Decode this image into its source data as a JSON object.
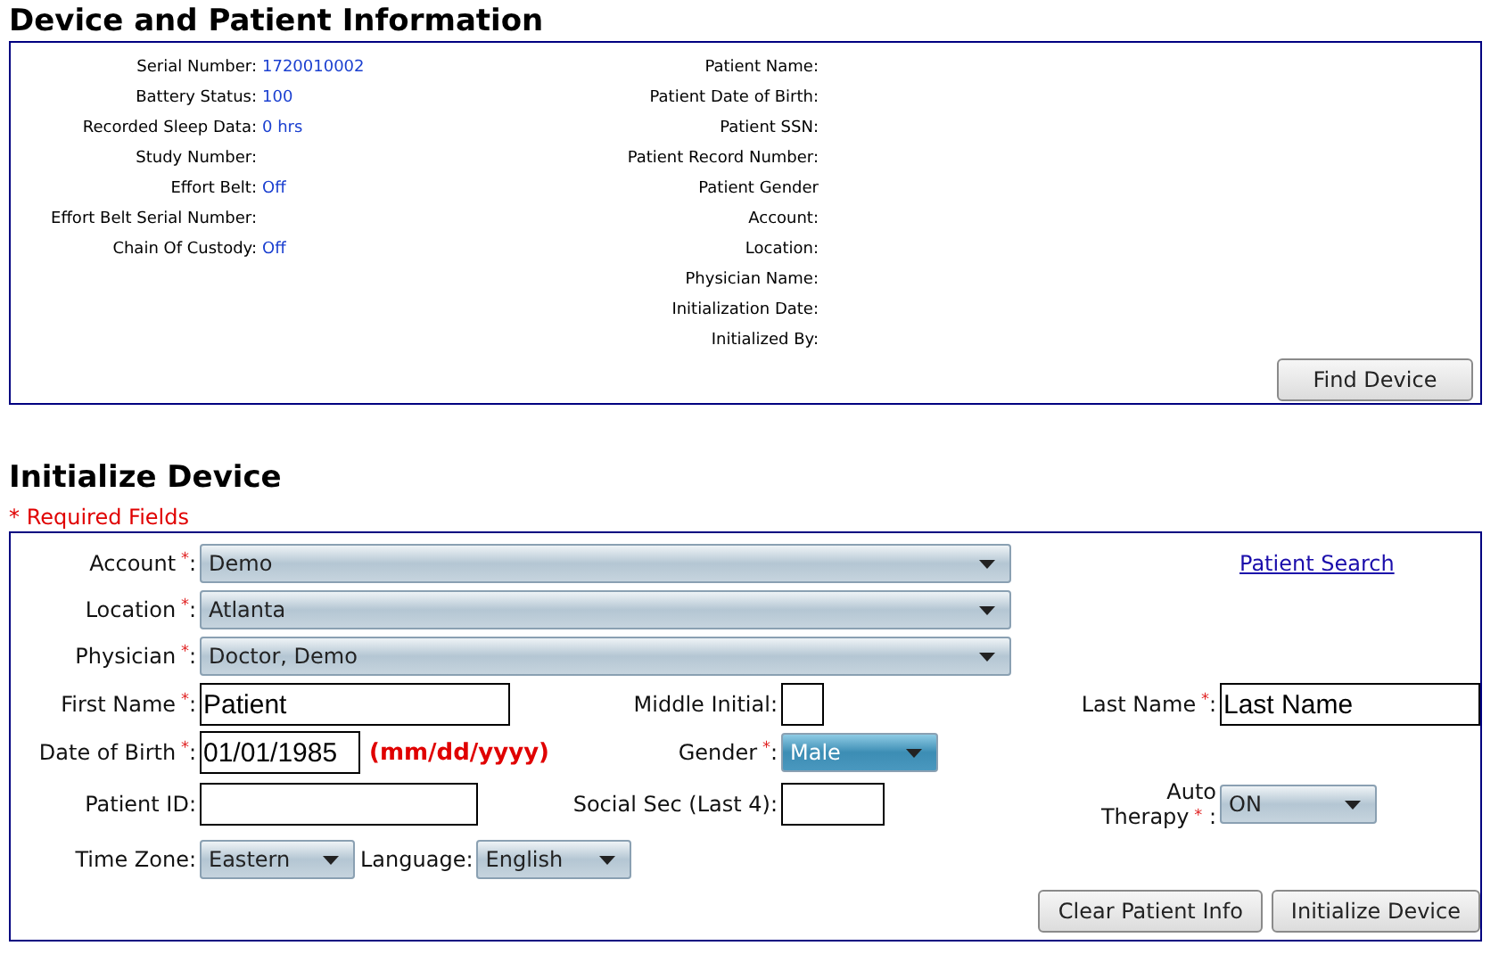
{
  "device_info": {
    "title": "Device and Patient Information",
    "device_fields": [
      {
        "label": "Serial Number:",
        "value": "1720010002"
      },
      {
        "label": "Battery Status:",
        "value": "100"
      },
      {
        "label": "Recorded Sleep Data:",
        "value": "0 hrs"
      },
      {
        "label": "Study Number:"
      },
      {
        "label": "Effort Belt:",
        "value": "Off"
      },
      {
        "label": "Effort Belt Serial Number:"
      },
      {
        "label": "Chain Of Custody:",
        "value": "Off"
      }
    ],
    "patient_fields": [
      {
        "label": "Patient Name:"
      },
      {
        "label": "Patient Date of Birth:"
      },
      {
        "label": "Patient SSN:"
      },
      {
        "label": "Patient Record Number:"
      },
      {
        "label": "Patient Gender"
      },
      {
        "label": "Account:"
      },
      {
        "label": "Location:"
      },
      {
        "label": "Physician Name:"
      },
      {
        "label": "Initialization Date:"
      },
      {
        "label": "Initialized By:"
      }
    ],
    "button": "Find Device"
  },
  "initialize_device": {
    "title": "Initialize Device",
    "required_note": "* Required Fields",
    "rows": [
      [
        {
          "kind": "select",
          "label": "Account",
          "required_mark": "*",
          "label_end": ":",
          "value": "Demo",
          "highlighted": false
        },
        {
          "kind": "link",
          "text": "Patient Search"
        }
      ],
      [
        {
          "kind": "select",
          "label": "Location",
          "required_mark": "*",
          "label_end": ":",
          "value": "Atlanta",
          "highlighted": false
        }
      ],
      [
        {
          "kind": "select",
          "label": "Physician",
          "required_mark": "*",
          "label_end": ":",
          "value": "Doctor, Demo",
          "highlighted": false
        }
      ],
      [
        {
          "kind": "text",
          "label": "First Name",
          "required_mark": "*",
          "label_end": ":",
          "value": "Patient"
        },
        {
          "kind": "text",
          "label": "Middle Initial:"
        },
        {
          "kind": "text",
          "label": "Last Name",
          "required_mark": "*",
          "label_end": ":",
          "value": "Last Name"
        }
      ],
      [
        {
          "kind": "text",
          "label": "Date of Birth",
          "required_mark": "*",
          "label_end": ":",
          "value": "01/01/1985",
          "hint": "(mm/dd/yyyy)"
        },
        {
          "kind": "select",
          "label": "Gender",
          "required_mark": "*",
          "label_end": ":",
          "value": "Male",
          "highlighted": true
        }
      ],
      [
        {
          "kind": "text",
          "label": "Patient ID:"
        },
        {
          "kind": "text",
          "label": "Social Sec (Last 4):"
        },
        {
          "kind": "select",
          "label": "Auto Therapy",
          "required_mark": "*",
          "label_end": ":",
          "value": "ON",
          "highlighted": false
        }
      ],
      [
        {
          "kind": "select",
          "label": "Time Zone:",
          "value": "Eastern",
          "highlighted": false
        },
        {
          "kind": "select",
          "label": "Language:",
          "value": "English",
          "highlighted": false
        }
      ]
    ],
    "buttons": [
      "Clear Patient Info",
      "Initialize Device"
    ]
  }
}
